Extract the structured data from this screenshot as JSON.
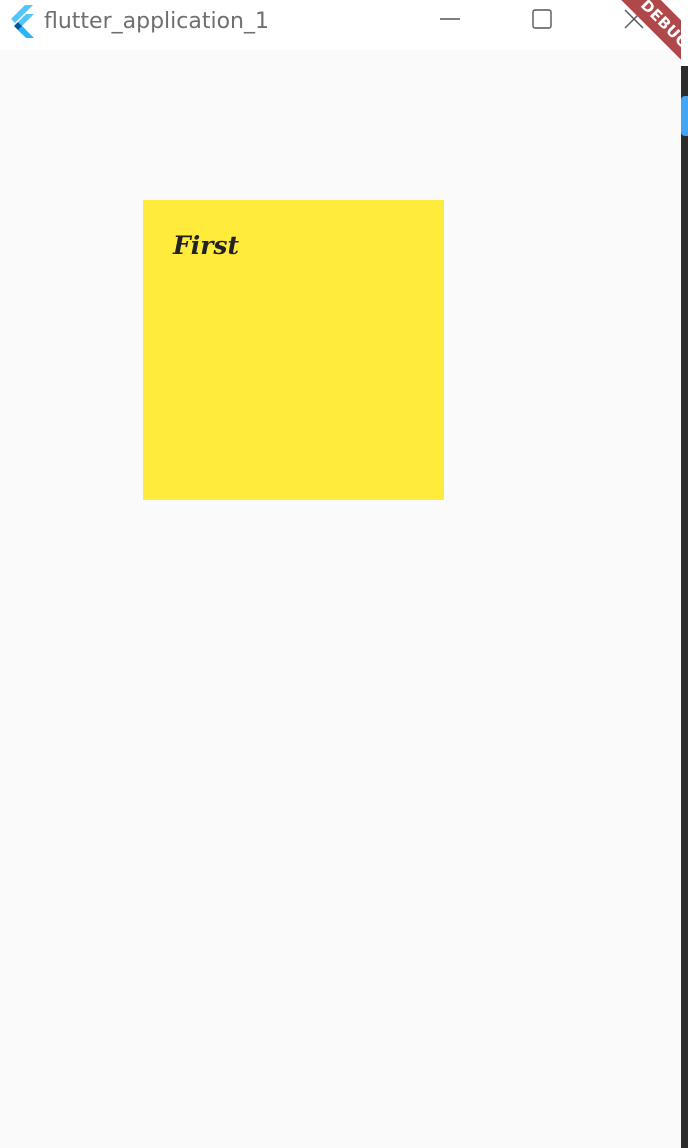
{
  "window": {
    "title": "flutter_application_1",
    "app_icon": "flutter-logo-icon",
    "controls": {
      "minimize_icon": "minimize-icon",
      "maximize_icon": "maximize-icon",
      "close_icon": "close-icon"
    }
  },
  "debug_banner": {
    "label": "DEBUG",
    "color": "#b0484b"
  },
  "card": {
    "label": "First",
    "color": "#ffeb3b"
  },
  "colors": {
    "background": "#fafafa",
    "titlebar": "#ffffff"
  }
}
